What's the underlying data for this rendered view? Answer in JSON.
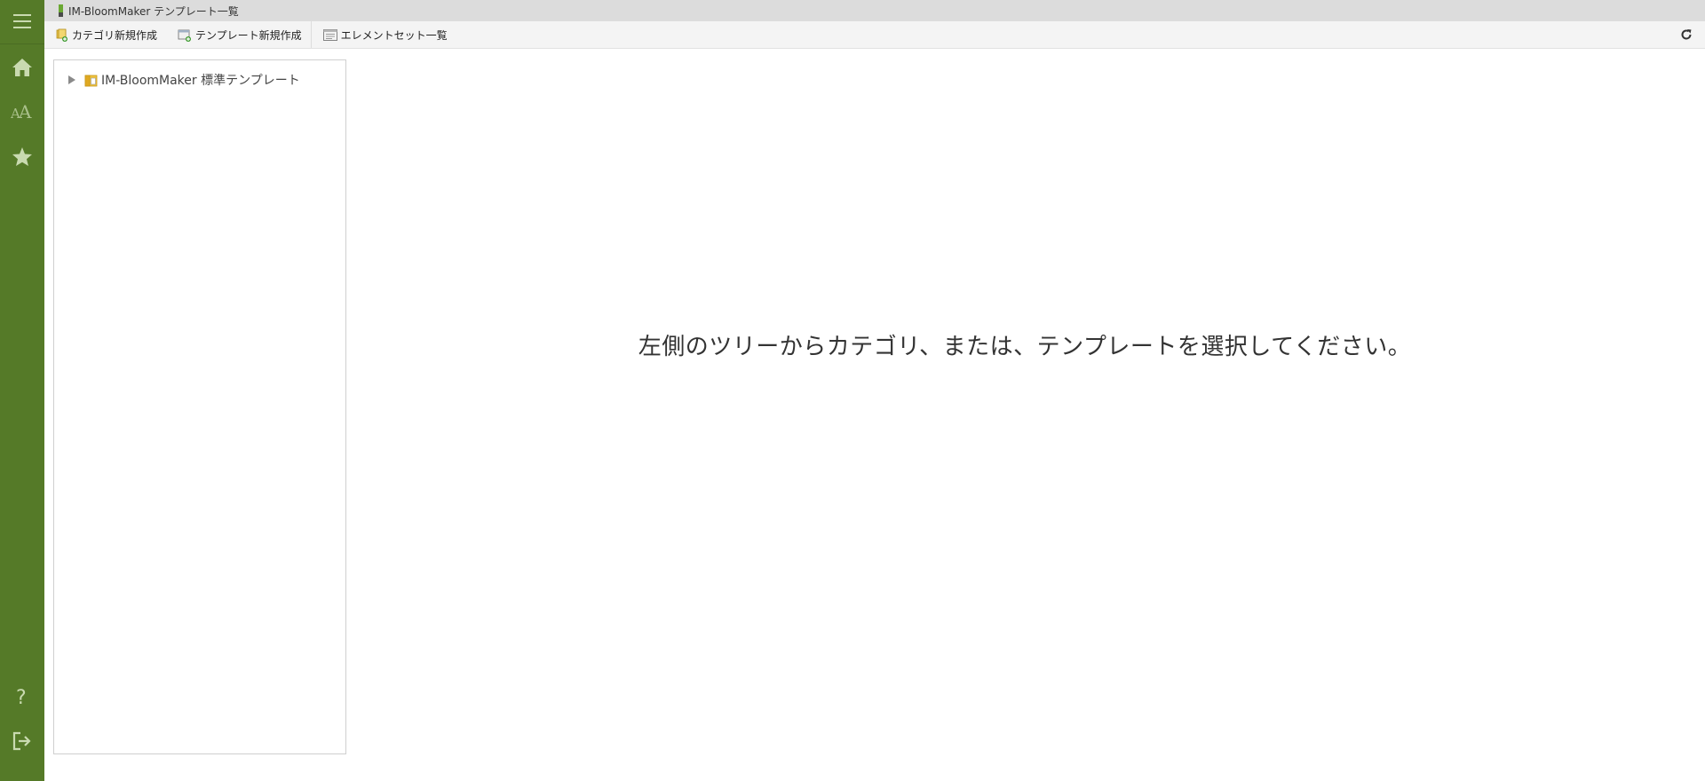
{
  "window": {
    "title": "IM-BloomMaker テンプレート一覧"
  },
  "sidenav": {
    "items": [
      {
        "icon": "hamburger-menu-icon"
      },
      {
        "icon": "home-icon"
      },
      {
        "icon": "font-size-icon"
      },
      {
        "icon": "star-icon"
      },
      {
        "icon": "help-icon"
      },
      {
        "icon": "logout-icon"
      }
    ],
    "background": "#557a28",
    "icon_color": "#c9dab0"
  },
  "toolbar": {
    "new_category_label": "カテゴリ新規作成",
    "new_template_label": "テンプレート新規作成",
    "element_set_list_label": "エレメントセット一覧",
    "refresh_icon": "refresh-icon"
  },
  "tree": {
    "nodes": [
      {
        "label": "IM-BloomMaker 標準テンプレート",
        "expanded": false,
        "icon": "folder-icon"
      }
    ]
  },
  "main": {
    "message": "左側のツリーからカテゴリ、または、テンプレートを選択してください。"
  }
}
